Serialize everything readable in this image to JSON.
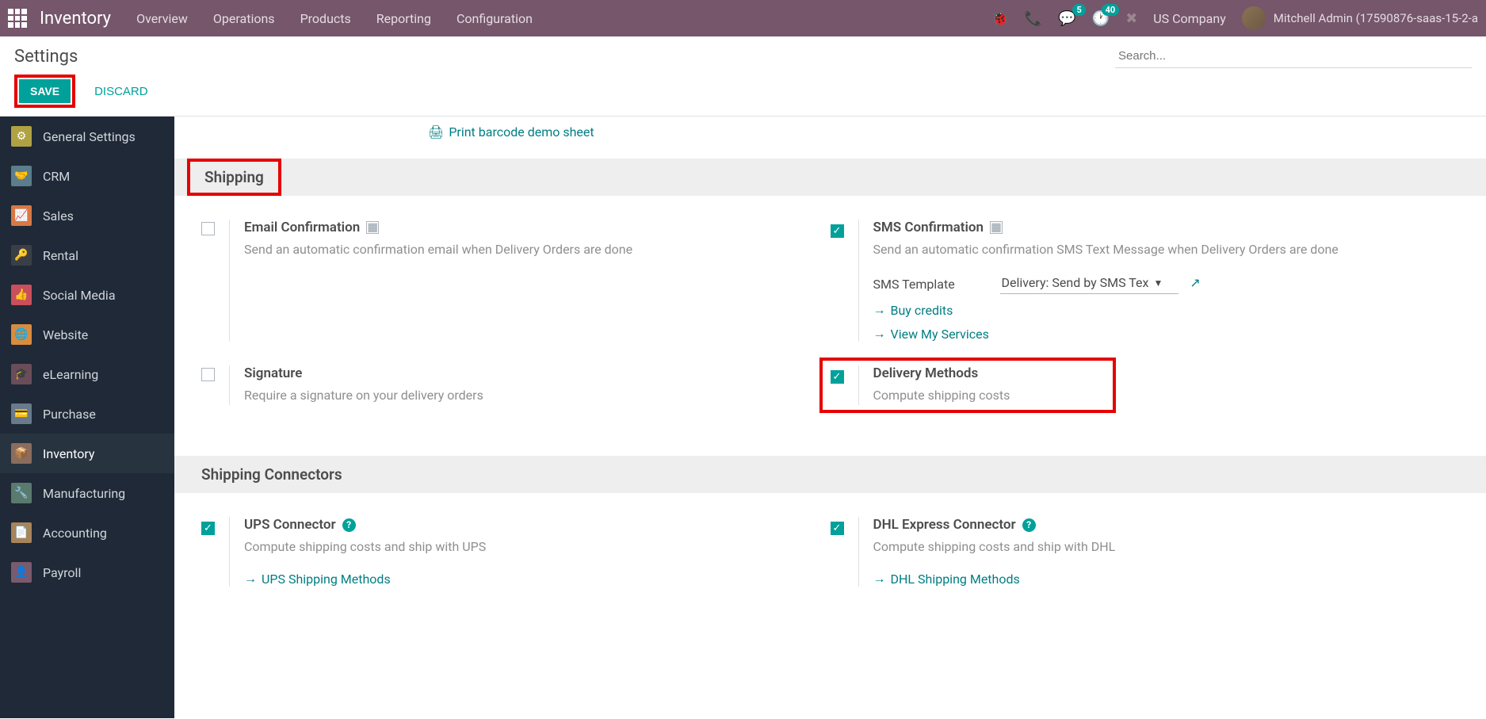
{
  "navbar": {
    "brand": "Inventory",
    "menu": [
      "Overview",
      "Operations",
      "Products",
      "Reporting",
      "Configuration"
    ],
    "msg_badge": "5",
    "activity_badge": "40",
    "company": "US Company",
    "username": "Mitchell Admin (17590876-saas-15-2-a"
  },
  "page": {
    "title": "Settings",
    "search_placeholder": "Search...",
    "save": "SAVE",
    "discard": "DISCARD"
  },
  "sidebar": [
    {
      "label": "General Settings",
      "icon": "ic-general",
      "glyph": "⚙"
    },
    {
      "label": "CRM",
      "icon": "ic-crm",
      "glyph": "🤝"
    },
    {
      "label": "Sales",
      "icon": "ic-sales",
      "glyph": "📈"
    },
    {
      "label": "Rental",
      "icon": "ic-rental",
      "glyph": "🔑"
    },
    {
      "label": "Social Media",
      "icon": "ic-social",
      "glyph": "👍"
    },
    {
      "label": "Website",
      "icon": "ic-website",
      "glyph": "🌐"
    },
    {
      "label": "eLearning",
      "icon": "ic-elearning",
      "glyph": "🎓"
    },
    {
      "label": "Purchase",
      "icon": "ic-purchase",
      "glyph": "💳"
    },
    {
      "label": "Inventory",
      "icon": "ic-inventory",
      "glyph": "📦",
      "active": true
    },
    {
      "label": "Manufacturing",
      "icon": "ic-manufacturing",
      "glyph": "🔧"
    },
    {
      "label": "Accounting",
      "icon": "ic-accounting",
      "glyph": "📄"
    },
    {
      "label": "Payroll",
      "icon": "ic-payroll",
      "glyph": "👤"
    }
  ],
  "top_link": "Print barcode demo sheet",
  "sections": {
    "shipping": {
      "title": "Shipping",
      "email_conf": {
        "title": "Email Confirmation",
        "desc": "Send an automatic confirmation email when Delivery Orders are done"
      },
      "sms_conf": {
        "title": "SMS Confirmation",
        "desc": "Send an automatic confirmation SMS Text Message when Delivery Orders are done",
        "template_label": "SMS Template",
        "template_value": "Delivery: Send by SMS Tex",
        "buy_credits": "Buy credits",
        "view_services": "View My Services"
      },
      "signature": {
        "title": "Signature",
        "desc": "Require a signature on your delivery orders"
      },
      "delivery": {
        "title": "Delivery Methods",
        "desc": "Compute shipping costs"
      }
    },
    "connectors": {
      "title": "Shipping Connectors",
      "ups": {
        "title": "UPS Connector",
        "desc": "Compute shipping costs and ship with UPS",
        "link": "UPS Shipping Methods"
      },
      "dhl": {
        "title": "DHL Express Connector",
        "desc": "Compute shipping costs and ship with DHL",
        "link": "DHL Shipping Methods"
      }
    }
  }
}
